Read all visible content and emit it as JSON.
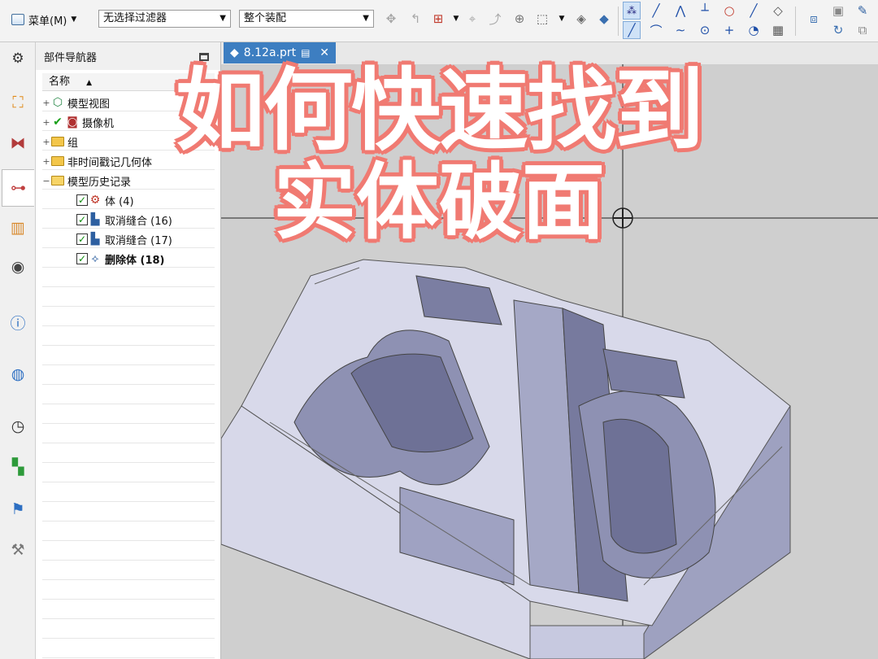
{
  "toolbar": {
    "menu_label": "菜单(M)",
    "selection_filter": "无选择过滤器",
    "assembly_scope": "整个装配"
  },
  "navigator": {
    "title": "部件导航器",
    "column_name": "名称",
    "items": [
      {
        "label": "模型视图",
        "icon": "model-views-icon",
        "expand": "+"
      },
      {
        "label": "摄像机",
        "icon": "camera-icon",
        "expand": "+"
      },
      {
        "label": "组",
        "icon": "folder-icon",
        "expand": "+"
      },
      {
        "label": "非时间戳记几何体",
        "icon": "folder-icon",
        "expand": "+"
      },
      {
        "label": "模型历史记录",
        "icon": "folder-open-icon",
        "expand": "−"
      },
      {
        "label": "体 (4)",
        "icon": "body-icon",
        "checked": true
      },
      {
        "label": "取消缝合 (16)",
        "icon": "unsew-icon",
        "checked": true
      },
      {
        "label": "取消缝合 (17)",
        "icon": "unsew-icon",
        "checked": true
      },
      {
        "label": "删除体 (18)",
        "icon": "delete-body-icon",
        "checked": true
      }
    ]
  },
  "tab": {
    "label": "8.12a.prt"
  },
  "overlay": {
    "line1": "如何快速找到",
    "line2": "实体破面"
  },
  "colors": {
    "accent": "#3d7ec1",
    "overlay_outline": "#f07a72",
    "model_face": "#b9bcd6"
  }
}
